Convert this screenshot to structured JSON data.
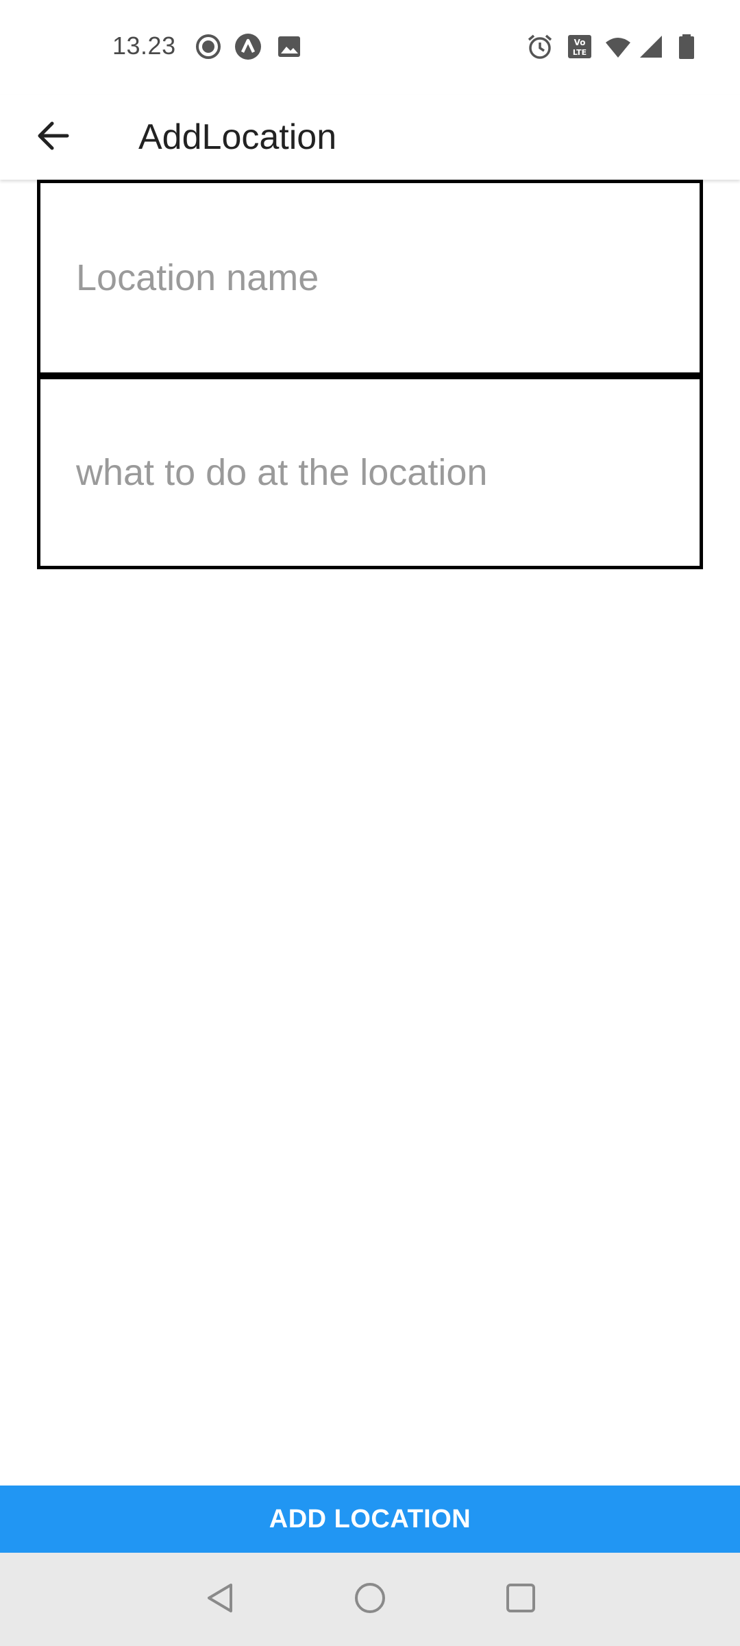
{
  "status_bar": {
    "time": "13.23",
    "icons": [
      "record-icon",
      "app-notification-icon",
      "image-icon",
      "alarm-icon",
      "volte-icon",
      "wifi-icon",
      "signal-icon",
      "battery-icon"
    ]
  },
  "app_bar": {
    "back_icon": "arrow-left-icon",
    "title": "AddLocation"
  },
  "form": {
    "location_name": {
      "placeholder": "Location name",
      "value": ""
    },
    "location_task": {
      "placeholder": "what to do at the location",
      "value": ""
    }
  },
  "action": {
    "add_label": "ADD LOCATION",
    "color": "#2196f3"
  },
  "nav_bar": {
    "icons": [
      "back-triangle-icon",
      "home-circle-icon",
      "recents-square-icon"
    ]
  }
}
